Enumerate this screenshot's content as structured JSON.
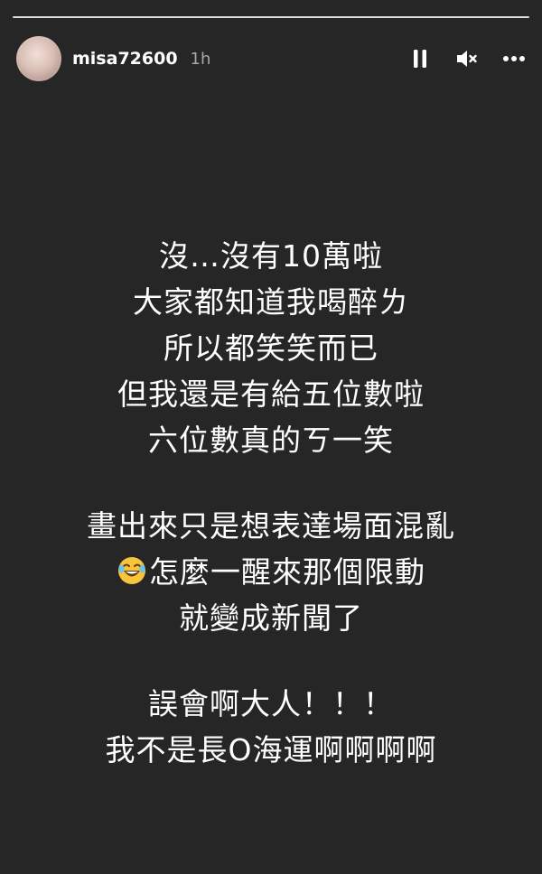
{
  "header": {
    "username": "misa72600",
    "timestamp": "1h",
    "icons": [
      "pause-icon",
      "mute-icon",
      "more-icon"
    ]
  },
  "message": {
    "lines": [
      "沒…沒有10萬啦",
      "大家都知道我喝醉ㄌ",
      "所以都笑笑而已",
      "但我還是有給五位數啦",
      "六位數真的ㄎ一笑",
      "畫出來只是想表達場面混亂",
      "怎麼一醒來那個限動",
      "就變成新聞了",
      "誤會啊大人！！！",
      "我不是長O海運啊啊啊啊"
    ],
    "emoji": "laughing-crying-emoji"
  },
  "colors": {
    "background": "#262626",
    "text": "#ffffff",
    "muted": "#a8a8a8"
  }
}
